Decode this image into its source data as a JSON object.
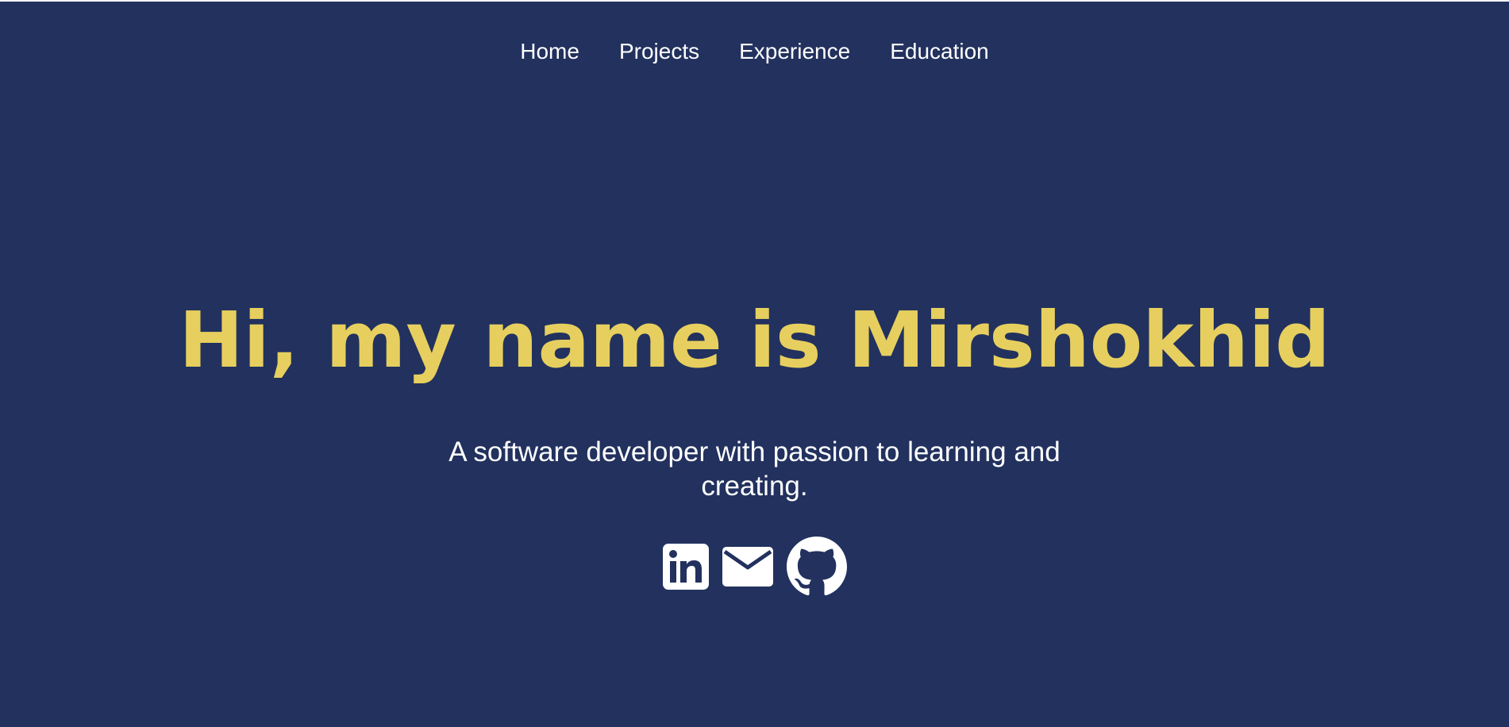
{
  "nav": {
    "items": [
      {
        "label": "Home"
      },
      {
        "label": "Projects"
      },
      {
        "label": "Experience"
      },
      {
        "label": "Education"
      }
    ]
  },
  "hero": {
    "title": "Hi, my name is Mirshokhid",
    "tagline": "A software developer with passion to learning and creating."
  },
  "socials": [
    {
      "icon": "linkedin-icon"
    },
    {
      "icon": "mail-icon"
    },
    {
      "icon": "github-icon"
    }
  ],
  "colors": {
    "background": "#22315e",
    "accent": "#e6cf5e",
    "text": "#ffffff"
  }
}
